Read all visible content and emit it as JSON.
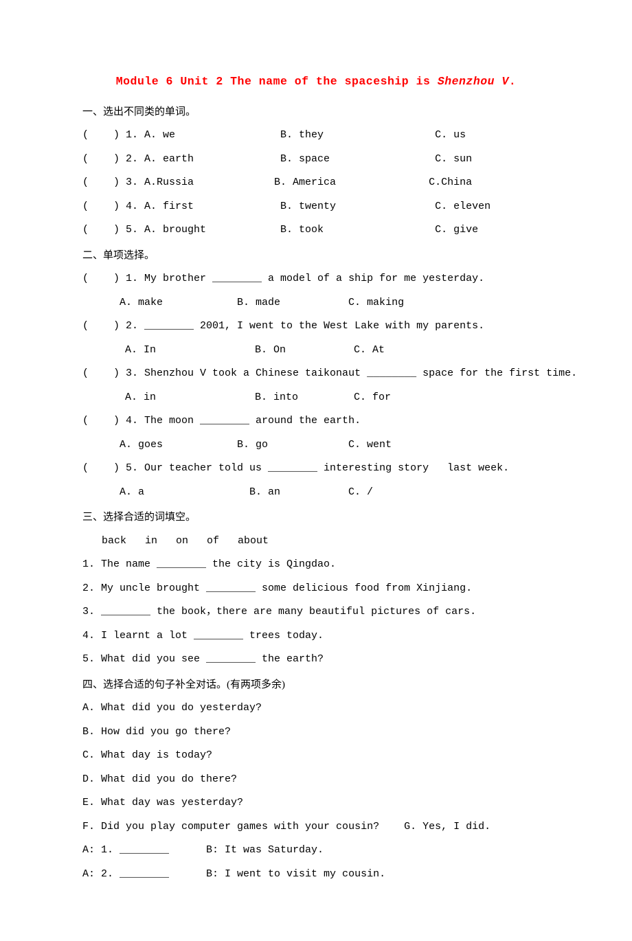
{
  "title": {
    "prefix": "Module 6 Unit 2 The name of the spaceship is ",
    "italic": "Shenzhou V",
    "suffix": "."
  },
  "sections": {
    "s1": {
      "header": "一、选出不同类的单词。",
      "q1": "(    ) 1. A. we                 B. they                  C. us",
      "q2": "(    ) 2. A. earth              B. space                 C. sun",
      "q3": "(    ) 3. A.Russia             B. America               C.China",
      "q4": "(    ) 4. A. first              B. twenty                C. eleven",
      "q5": "(    ) 5. A. brought            B. took                  C. give"
    },
    "s2": {
      "header": "二、单项选择。",
      "q1": "(    ) 1. My brother ________ a model of a ship for me yesterday.",
      "q1_opts": "A. make            B. made           C. making",
      "q2": "(    ) 2. ________ 2001, I went to the West Lake with my parents.",
      "q2_opts": "A. In                B. On           C. At",
      "q3": "(    ) 3. Shenzhou V took a Chinese taikonaut ________ space for the first time.",
      "q3_opts": "A. in                B. into         C. for",
      "q4": "(    ) 4. The moon ________ around the earth.",
      "q4_opts": "A. goes            B. go             C. went",
      "q5": "(    ) 5. Our teacher told us ________ interesting story   last week.",
      "q5_opts": "A. a                 B. an           C. /"
    },
    "s3": {
      "header": "三、选择合适的词填空。",
      "bank": "back   in   on   of   about",
      "q1": "1. The name ________ the city is Qingdao.",
      "q2": "2. My uncle brought ________ some delicious food from Xinjiang.",
      "q3": "3. ________ the book，there are many beautiful pictures of cars.",
      "q4": "4. I learnt a lot ________ trees today.",
      "q5": "5. What did you see ________ the earth?"
    },
    "s4": {
      "header": "四、选择合适的句子补全对话。(有两项多余)",
      "optA": "A. What did you do yesterday?",
      "optB": "B. How did you go there?",
      "optC": "C. What day is today?",
      "optD": "D. What did you do there?",
      "optE": "E. What day was yesterday?",
      "optFG": "F. Did you play computer games with your cousin?    G. Yes, I did.",
      "d1": "A: 1. ________      B: It was Saturday.",
      "d2": "A: 2. ________      B: I went to visit my cousin."
    }
  }
}
